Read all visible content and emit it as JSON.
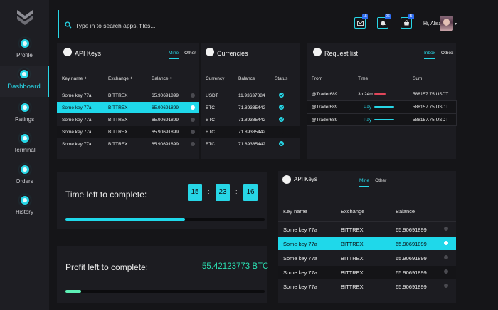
{
  "nav": {
    "items": [
      {
        "label": "Profile"
      },
      {
        "label": "Dashboard"
      },
      {
        "label": "Ratings"
      },
      {
        "label": "Terminal"
      },
      {
        "label": "Orders"
      },
      {
        "label": "History"
      }
    ],
    "active": "Dashboard"
  },
  "search": {
    "placeholder": "Type in to search apps, files..."
  },
  "header": {
    "mail_badge": "15",
    "alert_badge": "26",
    "store_badge": "5",
    "greeting": "Hi, Alisa"
  },
  "api_keys_small": {
    "title": "API Keys",
    "tabs": [
      "Mine",
      "Other"
    ],
    "columns": [
      "Key name",
      "Exchange",
      "Balance"
    ],
    "rows": [
      {
        "key": "Some key 77a",
        "exchange": "BITTREX",
        "balance": "65.90691899"
      },
      {
        "key": "Some key 77a",
        "exchange": "BITTREX",
        "balance": "65.90691899"
      },
      {
        "key": "Some key 77a",
        "exchange": "BITTREX",
        "balance": "65.90691899"
      },
      {
        "key": "Some key 77a",
        "exchange": "BITTREX",
        "balance": "65.90691899"
      },
      {
        "key": "Some key 77a",
        "exchange": "BITTREX",
        "balance": "65.90691899"
      }
    ]
  },
  "currencies": {
    "title": "Currencies",
    "columns": [
      "Currency",
      "Balance",
      "Status"
    ],
    "rows": [
      {
        "currency": "USDT",
        "balance": "11.93637884"
      },
      {
        "currency": "BTC",
        "balance": "71.89385442"
      },
      {
        "currency": "BTC",
        "balance": "71.89385442"
      },
      {
        "currency": "BTC",
        "balance": "71.89385442"
      },
      {
        "currency": "BTC",
        "balance": "71.89385442"
      }
    ]
  },
  "requests": {
    "title": "Request list",
    "tabs": [
      "Inbox",
      "Otbox"
    ],
    "columns": [
      "From",
      "Time",
      "Sum"
    ],
    "rows": [
      {
        "from": "@Trader689",
        "time": "3h 24m",
        "sum": "588157.75 USDT"
      },
      {
        "from": "@Trader689",
        "time": "Pay",
        "sum": "588157.75 USDT"
      },
      {
        "from": "@Trader689",
        "time": "Pay",
        "sum": "588157.75 USDT"
      }
    ]
  },
  "timer": {
    "label": "Time left to complete:",
    "hours": "15",
    "minutes": "23",
    "seconds": "16",
    "progress": 0.6
  },
  "profit": {
    "label": "Profit left to complete:",
    "value": "55.42123773 BTC",
    "progress": 0.08
  },
  "api_keys_large": {
    "title": "API Keys",
    "tabs": [
      "Mine",
      "Other"
    ],
    "columns": [
      "Key name",
      "Exchange",
      "Balance"
    ],
    "rows": [
      {
        "key": "Some key 77a",
        "exchange": "BITTREX",
        "balance": "65.90691899"
      },
      {
        "key": "Some key 77a",
        "exchange": "BITTREX",
        "balance": "65.90691899"
      },
      {
        "key": "Some key 77a",
        "exchange": "BITTREX",
        "balance": "65.90691899"
      },
      {
        "key": "Some key 77a",
        "exchange": "BITTREX",
        "balance": "65.90691899"
      },
      {
        "key": "Some key 77a",
        "exchange": "BITTREX",
        "balance": "65.90691899"
      }
    ]
  },
  "colors": {
    "accent": "#27d6e6",
    "profit": "#2ae0b2",
    "background": "#151518",
    "panel": "#1c1c21"
  }
}
